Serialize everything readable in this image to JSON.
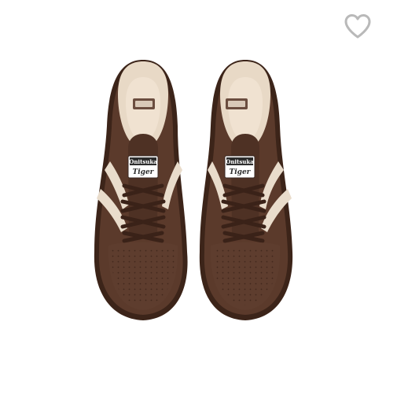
{
  "wishlist": {
    "icon": "heart-outline-icon",
    "color": "#b9b9b9"
  },
  "product": {
    "image_alt_colors": {
      "suede": "#5b3a2b",
      "suede_dark": "#3e271d",
      "stripe": "#e9dccb",
      "lining": "#eddccb"
    },
    "logo_line1": "Onitsuka",
    "logo_line2": "Tiger"
  }
}
